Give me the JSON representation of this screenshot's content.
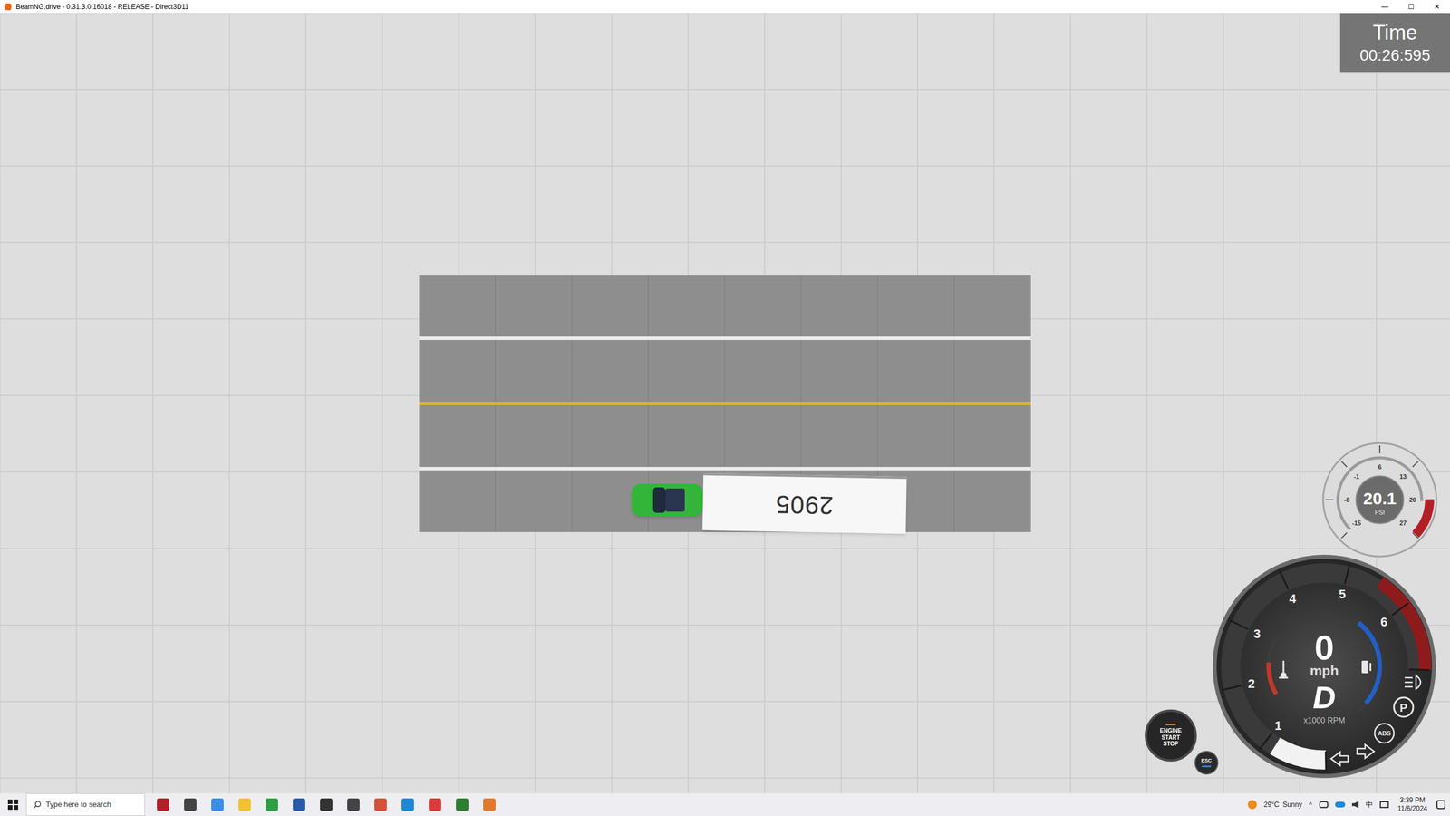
{
  "window": {
    "title": "BeamNG.drive - 0.31.3.0.16018 - RELEASE - Direct3D11",
    "controls": [
      "—",
      "☐",
      "✕"
    ]
  },
  "timer": {
    "label": "Time",
    "value": "00:26:595"
  },
  "trailer": {
    "number": "2905"
  },
  "boost_gauge": {
    "value": "20.1",
    "unit": "PSI",
    "ticks": [
      "-15",
      "-8",
      "-1",
      "6",
      "13",
      "20",
      "27"
    ],
    "level": 0.84
  },
  "main_gauge": {
    "speed": "0",
    "unit": "mph",
    "gear": "D",
    "rpm_label": "x1000 RPM",
    "ticks": [
      "1",
      "2",
      "3",
      "4",
      "5",
      "6"
    ],
    "rpm_level": 0.12,
    "temp_level": 0.55,
    "fuel_level": 0.9,
    "parking_label": "P",
    "abs_label": "ABS"
  },
  "engine_button": {
    "lines": [
      "ENGINE",
      "START",
      "STOP"
    ]
  },
  "esc_button": {
    "label": "ESC"
  },
  "taskbar": {
    "search_placeholder": "Type here to search",
    "tray_arrow": "^",
    "weather": "29°C  Sunny",
    "ime": "中",
    "time": "3:39 PM",
    "date": "11/6/2024"
  }
}
